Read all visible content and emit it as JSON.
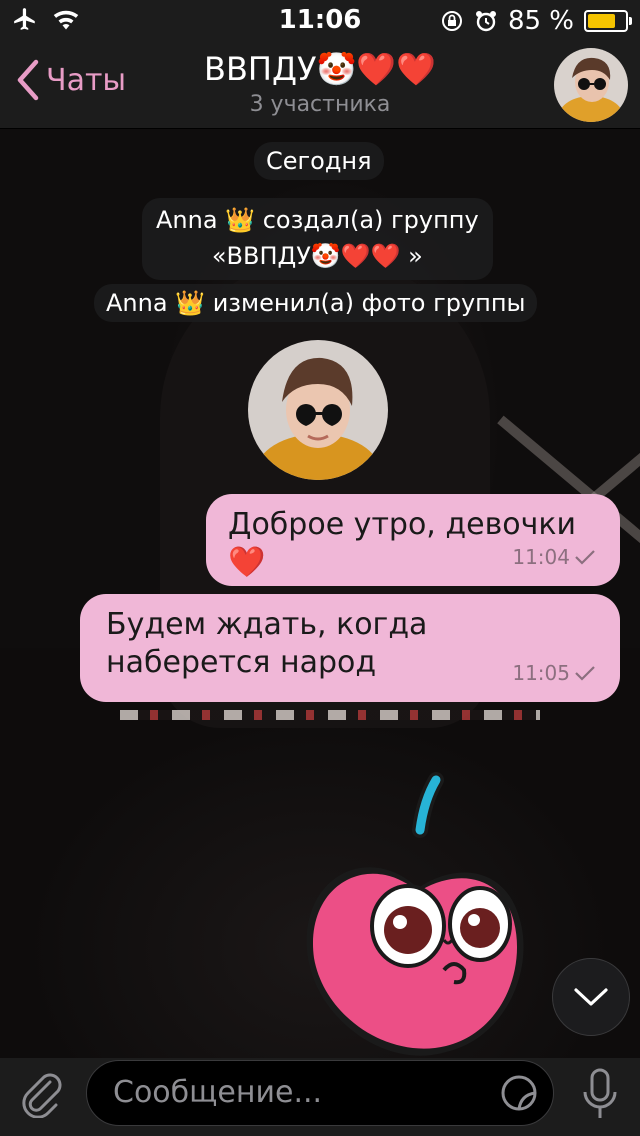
{
  "status_bar": {
    "time": "11:06",
    "battery": "85 %",
    "battery_level": 0.85,
    "icons": [
      "airplane-icon",
      "wifi-icon",
      "rotation-lock-icon",
      "alarm-icon",
      "battery-icon"
    ]
  },
  "header": {
    "back_label": "Чаты",
    "title": "ВВПДУ🤡❤️❤️",
    "subtitle": "3 участника"
  },
  "chat": {
    "date_label": "Сегодня",
    "events": [
      {
        "line1": "Anna 👑 создал(а) группу",
        "line2": "«ВВПДУ🤡❤️❤️ »"
      },
      {
        "line1": "Anna 👑 изменил(а) фото группы"
      }
    ],
    "messages": [
      {
        "text": "Доброе утро, девочки❤️",
        "time": "11:04"
      },
      {
        "text": "Будем ждать, когда наберется народ",
        "time": "11:05"
      }
    ]
  },
  "input": {
    "placeholder": "Сообщение..."
  },
  "colors": {
    "accent": "#e89cc6",
    "bubble": "#f0b7d7",
    "bar": "#1c1c1c",
    "battery": "#f5c400"
  }
}
